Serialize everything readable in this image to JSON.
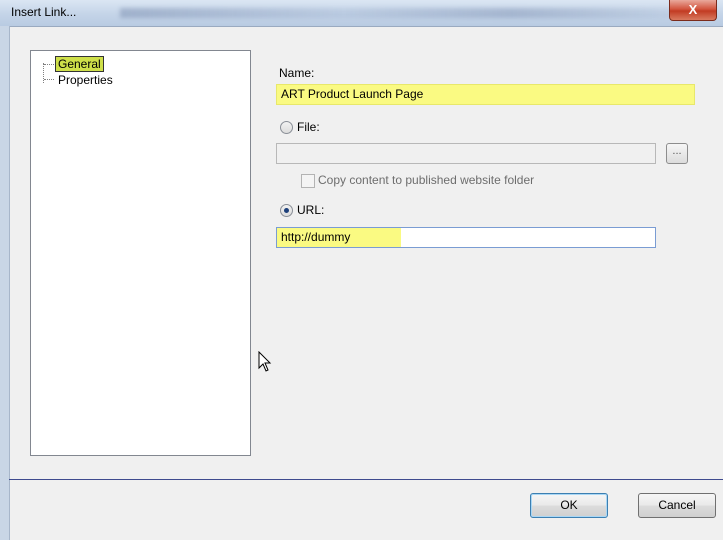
{
  "window": {
    "title": "Insert Link...",
    "close_glyph": "X"
  },
  "tree": {
    "items": [
      {
        "label": "General",
        "selected": true
      },
      {
        "label": "Properties",
        "selected": false
      }
    ]
  },
  "form": {
    "name_label": "Name:",
    "name_value": "ART Product Launch Page",
    "file_label": "File:",
    "file_value": "",
    "browse_label": "...",
    "copy_checkbox_label": "Copy content to published website folder",
    "copy_checked": false,
    "url_label": "URL:",
    "url_value": "http://dummy",
    "selected_source": "URL"
  },
  "buttons": {
    "ok_label": "OK",
    "cancel_label": "Cancel"
  },
  "colors": {
    "highlight": "#fafa82",
    "separator": "#3e4a8e"
  }
}
